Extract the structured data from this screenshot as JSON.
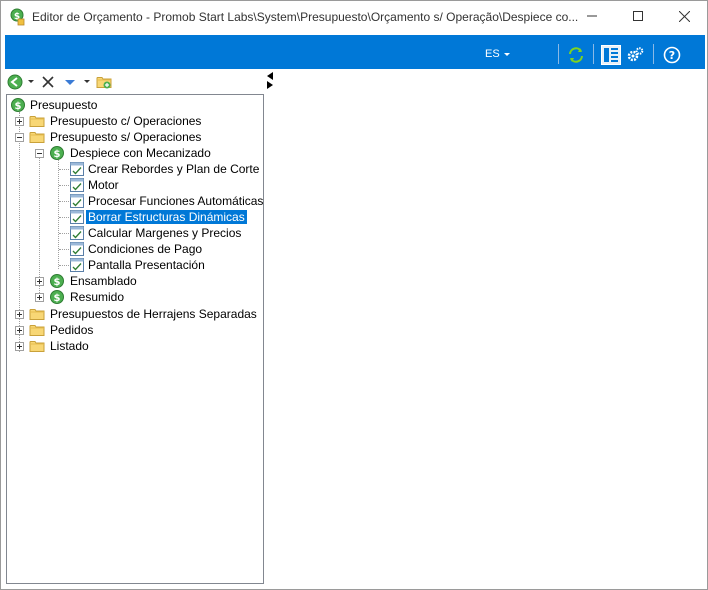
{
  "window": {
    "title": "Editor de Orçamento - Promob Start Labs\\System\\Presupuesto\\Orçamento s/ Operação\\Despiece co...",
    "minimize_glyph": "—",
    "maximize_glyph": "☐",
    "close_glyph": "✕"
  },
  "toolbar": {
    "language": "ES",
    "accent_color": "#0078d7",
    "icons": [
      "refresh-icon",
      "layout-icon",
      "settings-icon",
      "help-icon"
    ]
  },
  "tree_toolbar": {
    "icons": [
      "back-icon",
      "delete-icon",
      "move-down-icon",
      "add-folder-icon"
    ]
  },
  "tree": {
    "root": "Presupuesto",
    "items": [
      {
        "label": "Presupuesto c/ Operaciones"
      },
      {
        "label": "Presupuesto s/ Operaciones"
      },
      {
        "label": "Despiece con Mecanizado"
      },
      {
        "label": "Crear Rebordes y Plan de Corte"
      },
      {
        "label": "Motor"
      },
      {
        "label": "Procesar Funciones Automáticas"
      },
      {
        "label": "Borrar Estructuras Dinámicas",
        "selected": true
      },
      {
        "label": "Calcular Margenes y Precios"
      },
      {
        "label": "Condiciones de Pago"
      },
      {
        "label": "Pantalla Presentación"
      },
      {
        "label": "Ensamblado"
      },
      {
        "label": "Resumido"
      },
      {
        "label": "Presupuestos de Herrajens Separadas"
      },
      {
        "label": "Pedidos"
      },
      {
        "label": "Listado"
      }
    ]
  }
}
